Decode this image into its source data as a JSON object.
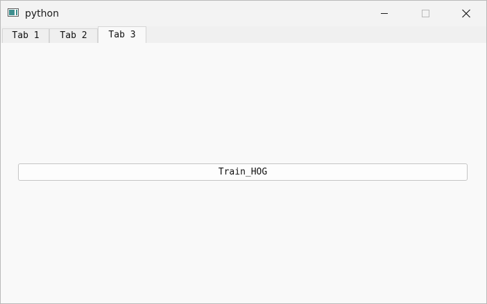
{
  "window": {
    "title": "python",
    "icon": "window-app-icon",
    "controls": {
      "minimize_icon": "minimize-icon",
      "maximize_icon": "maximize-icon",
      "close_icon": "close-icon"
    }
  },
  "tabs": [
    {
      "label": "Tab 1",
      "selected": false
    },
    {
      "label": "Tab 2",
      "selected": false
    },
    {
      "label": "Tab 3",
      "selected": true
    }
  ],
  "main": {
    "train_button_label": "Train_HOG"
  },
  "colors": {
    "window_background": "#f9f9f9",
    "titlebar_background": "#f3f3f3",
    "tab_background": "#efefef",
    "button_background": "#fdfdfd",
    "app_icon_accent": "#3f8f8f"
  }
}
